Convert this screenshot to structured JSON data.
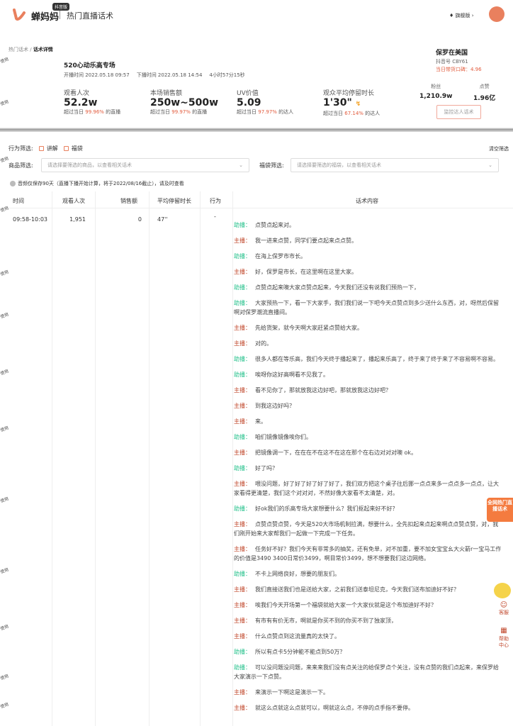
{
  "header": {
    "brand": "蝉妈妈",
    "badge": "抖音版",
    "subtitle": "热门直播话术",
    "vip": "旗舰版 ›"
  },
  "breadcrumb": {
    "parent": "热门话术 / ",
    "current": "话术详情"
  },
  "live": {
    "title": "520心动乐高专场",
    "start": "开播时间 2022.05.18 09:57",
    "end": "下播时间 2022.05.18 14:54",
    "duration": "4小时57分15秒"
  },
  "stats": [
    {
      "label": "观看人次",
      "value": "52.2w",
      "pre": "超过当日 ",
      "pct": "99.96%",
      "post": " 的直播"
    },
    {
      "label": "本场销售额",
      "value": "250w~500w",
      "pre": "超过当日 ",
      "pct": "99.97%",
      "post": " 的直播"
    },
    {
      "label": "UV价值",
      "value": "5.09",
      "pre": "超过当日 ",
      "pct": "97.97%",
      "post": " 的达人"
    },
    {
      "label": "观众平均停留时长",
      "value": "1'30\"",
      "pre": "超过当日 ",
      "pct": "67.14%",
      "post": " 的达人"
    }
  ],
  "anchor": {
    "name": "保罗在美国",
    "id": "抖音号 CBY61",
    "score": "当日带货口碑：4.96",
    "fans_label": "粉丝",
    "fans": "1,210.9w",
    "likes_label": "点赞",
    "likes": "1.96亿",
    "monitor": "监控达人话术"
  },
  "filters": {
    "behavior_label": "行为筛选:",
    "opt1": "讲解",
    "opt2": "福袋",
    "clear": "清空筛选",
    "product_label": "商品筛选:",
    "product_ph": "请选择要筛选的商品，以查看相关话术",
    "bag_label": "福袋筛选:",
    "bag_ph": "请选择要筛选的福袋，以查看相关话术",
    "notice": "音频仅保存90天（直播下播开始计算，将于2022/08/16截止），请及时查看"
  },
  "table": {
    "headers": [
      "时间",
      "观看人次",
      "销售额",
      "平均停留时长",
      "行为",
      "话术内容"
    ],
    "row": {
      "time": "09:58-10:03",
      "viewers": "1,951",
      "sales": "0",
      "stay": "47''",
      "action": "-"
    }
  },
  "roles": {
    "host": "主播：",
    "assistant": "助播："
  },
  "transcript": [
    {
      "r": "assistant",
      "t": "点赞点起来对。"
    },
    {
      "r": "host",
      "t": "我一进来点赞，同学们要点起来点点赞。"
    },
    {
      "r": "assistant",
      "t": "在海上保罗市市长。"
    },
    {
      "r": "host",
      "t": "好，保罗是市长，在这里啊在这里大家。"
    },
    {
      "r": "assistant",
      "t": "点赞点起来噢大家点赞点起来，今天我们还没有说我们预热一下，"
    },
    {
      "r": "assistant",
      "t": "大家预热一下，看一下大家手，我们我们说一下吧今天点赞点到多少送什么东西，对，呀然后保留啊对保罗潮流直播间。"
    },
    {
      "r": "host",
      "t": "先给货架，就今天啊大家赶紧点赞给大家。"
    },
    {
      "r": "host",
      "t": "对的。"
    },
    {
      "r": "assistant",
      "t": "很多人都在等乐高，我们今天终于播起来了，播起来乐高了，终于来了终于来了不容易啊不容易。"
    },
    {
      "r": "assistant",
      "t": "唉呀你这好高啊看不见我了。"
    },
    {
      "r": "host",
      "t": "看不见你了，那就放我这边好吧，那就放我这边好吧？"
    },
    {
      "r": "host",
      "t": "到我这边好吗？"
    },
    {
      "r": "host",
      "t": "来。"
    },
    {
      "r": "assistant",
      "t": "咱们镜像镜像唉你们。"
    },
    {
      "r": "host",
      "t": "把镜像调一下，在在在不在这不在这在那个在右边对对对噢 ok。"
    },
    {
      "r": "assistant",
      "t": "好了吗？"
    },
    {
      "r": "host",
      "t": "喂没问题，好了好了好了好了好了，我们双方把这个桌子往后挪一点点来多一点点多一点点，让大家看得更清楚，我们这个对对对，不然好像大家看不太清楚，对。"
    },
    {
      "r": "assistant",
      "t": "好ok我们的乐高专场大家想要什么？我们抠起来好不好？"
    },
    {
      "r": "host",
      "t": "点赞点赞点赞，今天是520大市场机制拉满，想要什么，全先扣起来点起来啊点点赞点赞，对，我们刚开始来大家帮我们一起做一下完成一下任务。"
    },
    {
      "r": "host",
      "t": "任务好不好？我们今天有非常多的抽奖，还有免单，对不加重，要不加女宝宝幺大火箭r一宝马工作的价值是3490 3400日常价3499，啊目常价3499，想不想要我们这边网络。"
    },
    {
      "r": "assistant",
      "t": "不卡上网络良好，想要的朋友们。"
    },
    {
      "r": "host",
      "t": "我们直接送我们也是送给大家，之前我们送泰坦尼克，今天我们送布加迪好不好？"
    },
    {
      "r": "host",
      "t": "唉我们今天开场第一个福袋就给大家一个大家伙就是这个布加迪好不好？"
    },
    {
      "r": "host",
      "t": "有市有有价无市，啊就是你买不到的你买不到了独家顶，"
    },
    {
      "r": "host",
      "t": "什么点赞点到这流量真的太快了。"
    },
    {
      "r": "assistant",
      "t": "所以有点卡5分钟能不能点到50万？"
    },
    {
      "r": "assistant",
      "t": "可以没问题没问题，来来来我们没有点关注的给保罗点个关注，没有点赞的我们点起来，来保罗给大家演示一下点赞。"
    },
    {
      "r": "host",
      "t": "来演示一下啊这是演示一下。"
    },
    {
      "r": "host",
      "t": "就这么点就这么点就可以，啊就这么点，不停的点手指不要停。"
    }
  ],
  "side": {
    "ad": "全网热门直播话术",
    "service": "客服",
    "help": "帮助中心"
  },
  "watermark": "使用",
  "colors": {
    "accent": "#e9805e",
    "host": "#c0462a",
    "assistant": "#22c08a"
  }
}
